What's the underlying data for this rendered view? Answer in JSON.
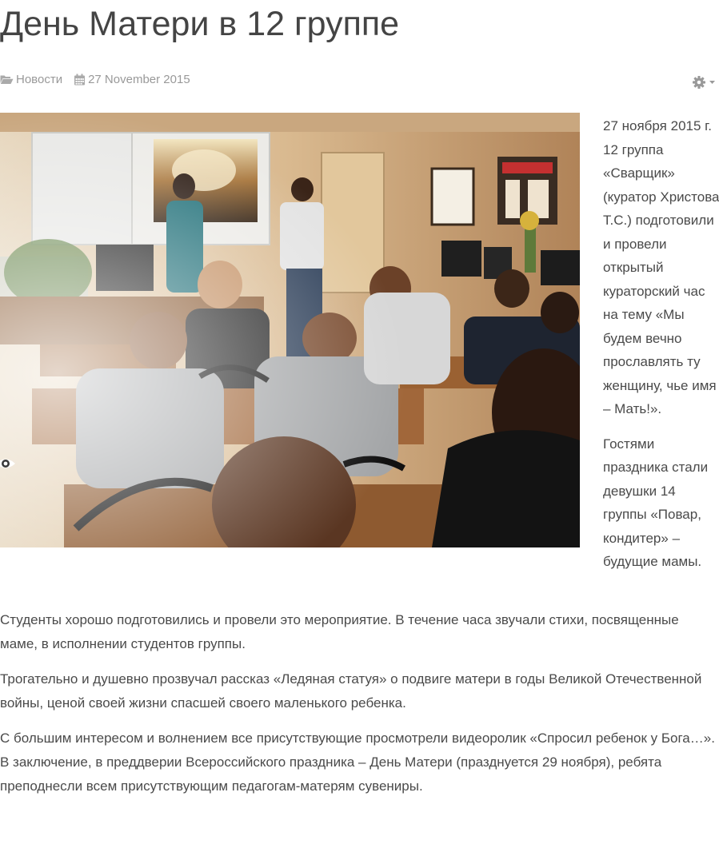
{
  "article": {
    "title": "День Матери в 12 группе",
    "category": "Новости",
    "date": "27 November 2015",
    "intro_paragraphs": [
      "27 ноября 2015 г. 12 группа «Сварщик» (куратор Христова Т.С.) подготовили и провели открытый кураторский час на тему «Мы будем вечно прославлять ту женщину, чье имя – Мать!».",
      "Гостями праздника стали девушки 14 группы «Повар, кондитер» – будущие мамы."
    ],
    "body_paragraphs": [
      "Студенты хорошо подготовились и провели это мероприятие. В течение часа звучали стихи, посвященные маме, в исполнении студентов группы.",
      "Трогательно и душевно прозвучал рассказ «Ледяная статуя» о подвиге матери в годы Великой Отечественной войны, ценой своей жизни спасшей своего маленького ребенка.",
      "С большим интересом и волнением все присутствующие просмотрели видеоролик «Спросил ребенок у Бога…». В заключение, в преддверии Всероссийского праздника – День Матери (празднуется 29 ноября), ребята преподнесли всем присутствующим педагогам-матерям сувениры."
    ]
  },
  "icons": {
    "category": "folder-open-icon",
    "date": "calendar-icon",
    "tools": "gear-icon",
    "tools_caret": "caret-down-icon",
    "photo_overlay": "eye-icon"
  },
  "colors": {
    "title": "#444444",
    "meta": "#999999",
    "text": "#4a4a4a",
    "background": "#ffffff"
  }
}
